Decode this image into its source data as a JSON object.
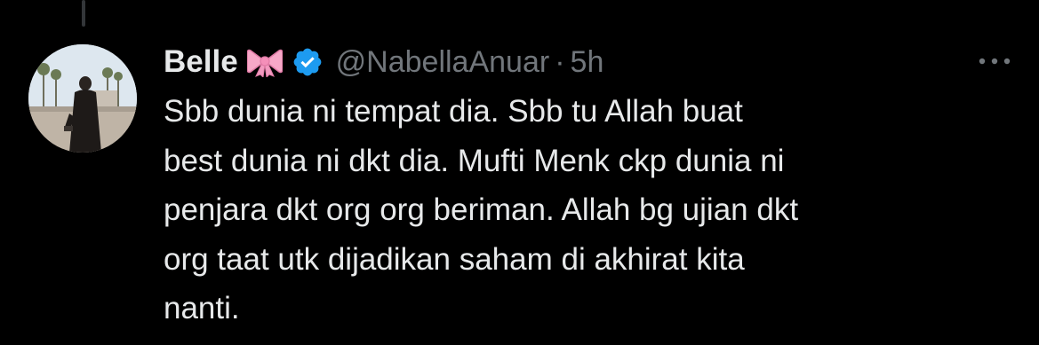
{
  "tweet": {
    "author": {
      "display_name": "Belle",
      "emoji": "🎀",
      "handle": "@NabellaAnuar",
      "verified": true
    },
    "separator": "·",
    "timestamp": "5h",
    "text": "Sbb dunia ni tempat dia. Sbb tu Allah buat\nbest dunia ni dkt dia. Mufti Menk ckp dunia ni\npenjara dkt org org beriman. Allah bg ujian dkt\norg taat utk dijadikan saham di akhirat kita\nnanti.",
    "icons": {
      "bow": "ribbon-bow-icon",
      "verified": "verified-badge-icon",
      "more": "more-options-icon"
    },
    "colors": {
      "background": "#000000",
      "text": "#e7e9ea",
      "secondary": "#71767b",
      "verified": "#1d9bf0",
      "bow": "#f7a8c8"
    }
  }
}
